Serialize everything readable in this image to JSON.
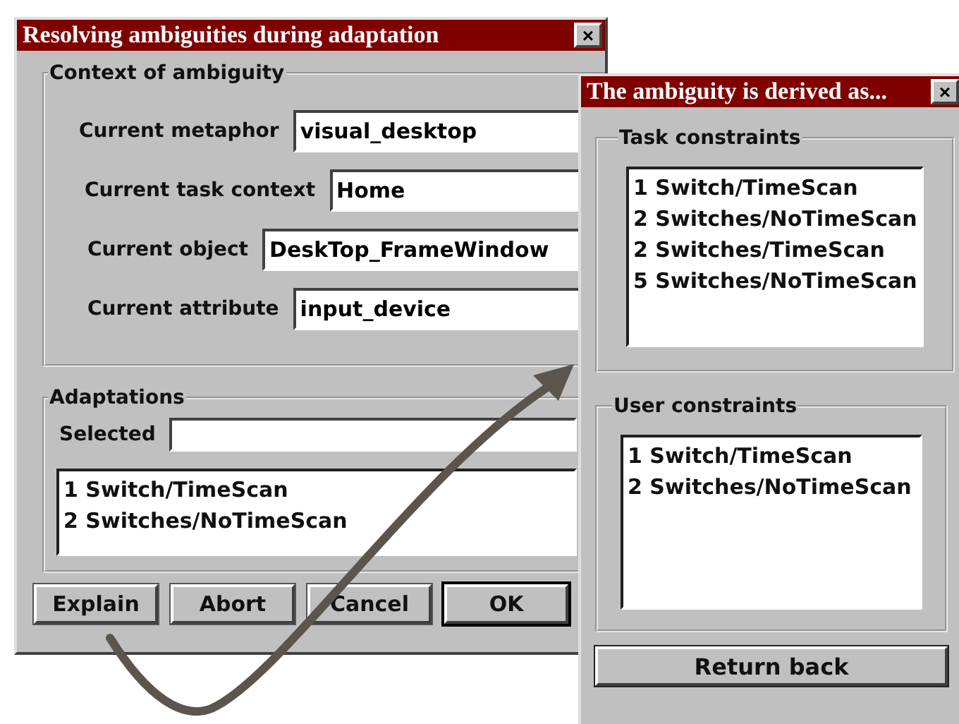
{
  "main_window": {
    "title": "Resolving ambiguities during adaptation",
    "close": "×",
    "context_group": {
      "title": "Context of ambiguity",
      "fields": [
        {
          "label": "Current metaphor",
          "value": "visual_desktop"
        },
        {
          "label": "Current task context",
          "value": "Home"
        },
        {
          "label": "Current object",
          "value": "DeskTop_FrameWindow"
        },
        {
          "label": "Current attribute",
          "value": "input_device"
        }
      ]
    },
    "adaptations_group": {
      "title": "Adaptations",
      "selected_label": "Selected",
      "items": [
        "1 Switch/TimeScan",
        "2 Switches/NoTimeScan"
      ]
    },
    "buttons": [
      {
        "label": "Explain",
        "default": false
      },
      {
        "label": "Abort",
        "default": false
      },
      {
        "label": "Cancel",
        "default": false
      },
      {
        "label": "OK",
        "default": true
      }
    ]
  },
  "explain_window": {
    "title": "The ambiguity is derived as...",
    "close": "×",
    "task_constraints": {
      "title": "Task constraints",
      "items": [
        "1 Switch/TimeScan",
        "2 Switches/NoTimeScan",
        "2 Switches/TimeScan",
        "5 Switches/NoTimeScan"
      ]
    },
    "user_constraints": {
      "title": "User constraints",
      "items": [
        "1 Switch/TimeScan",
        "2 Switches/NoTimeScan"
      ]
    },
    "button": "Return back"
  }
}
